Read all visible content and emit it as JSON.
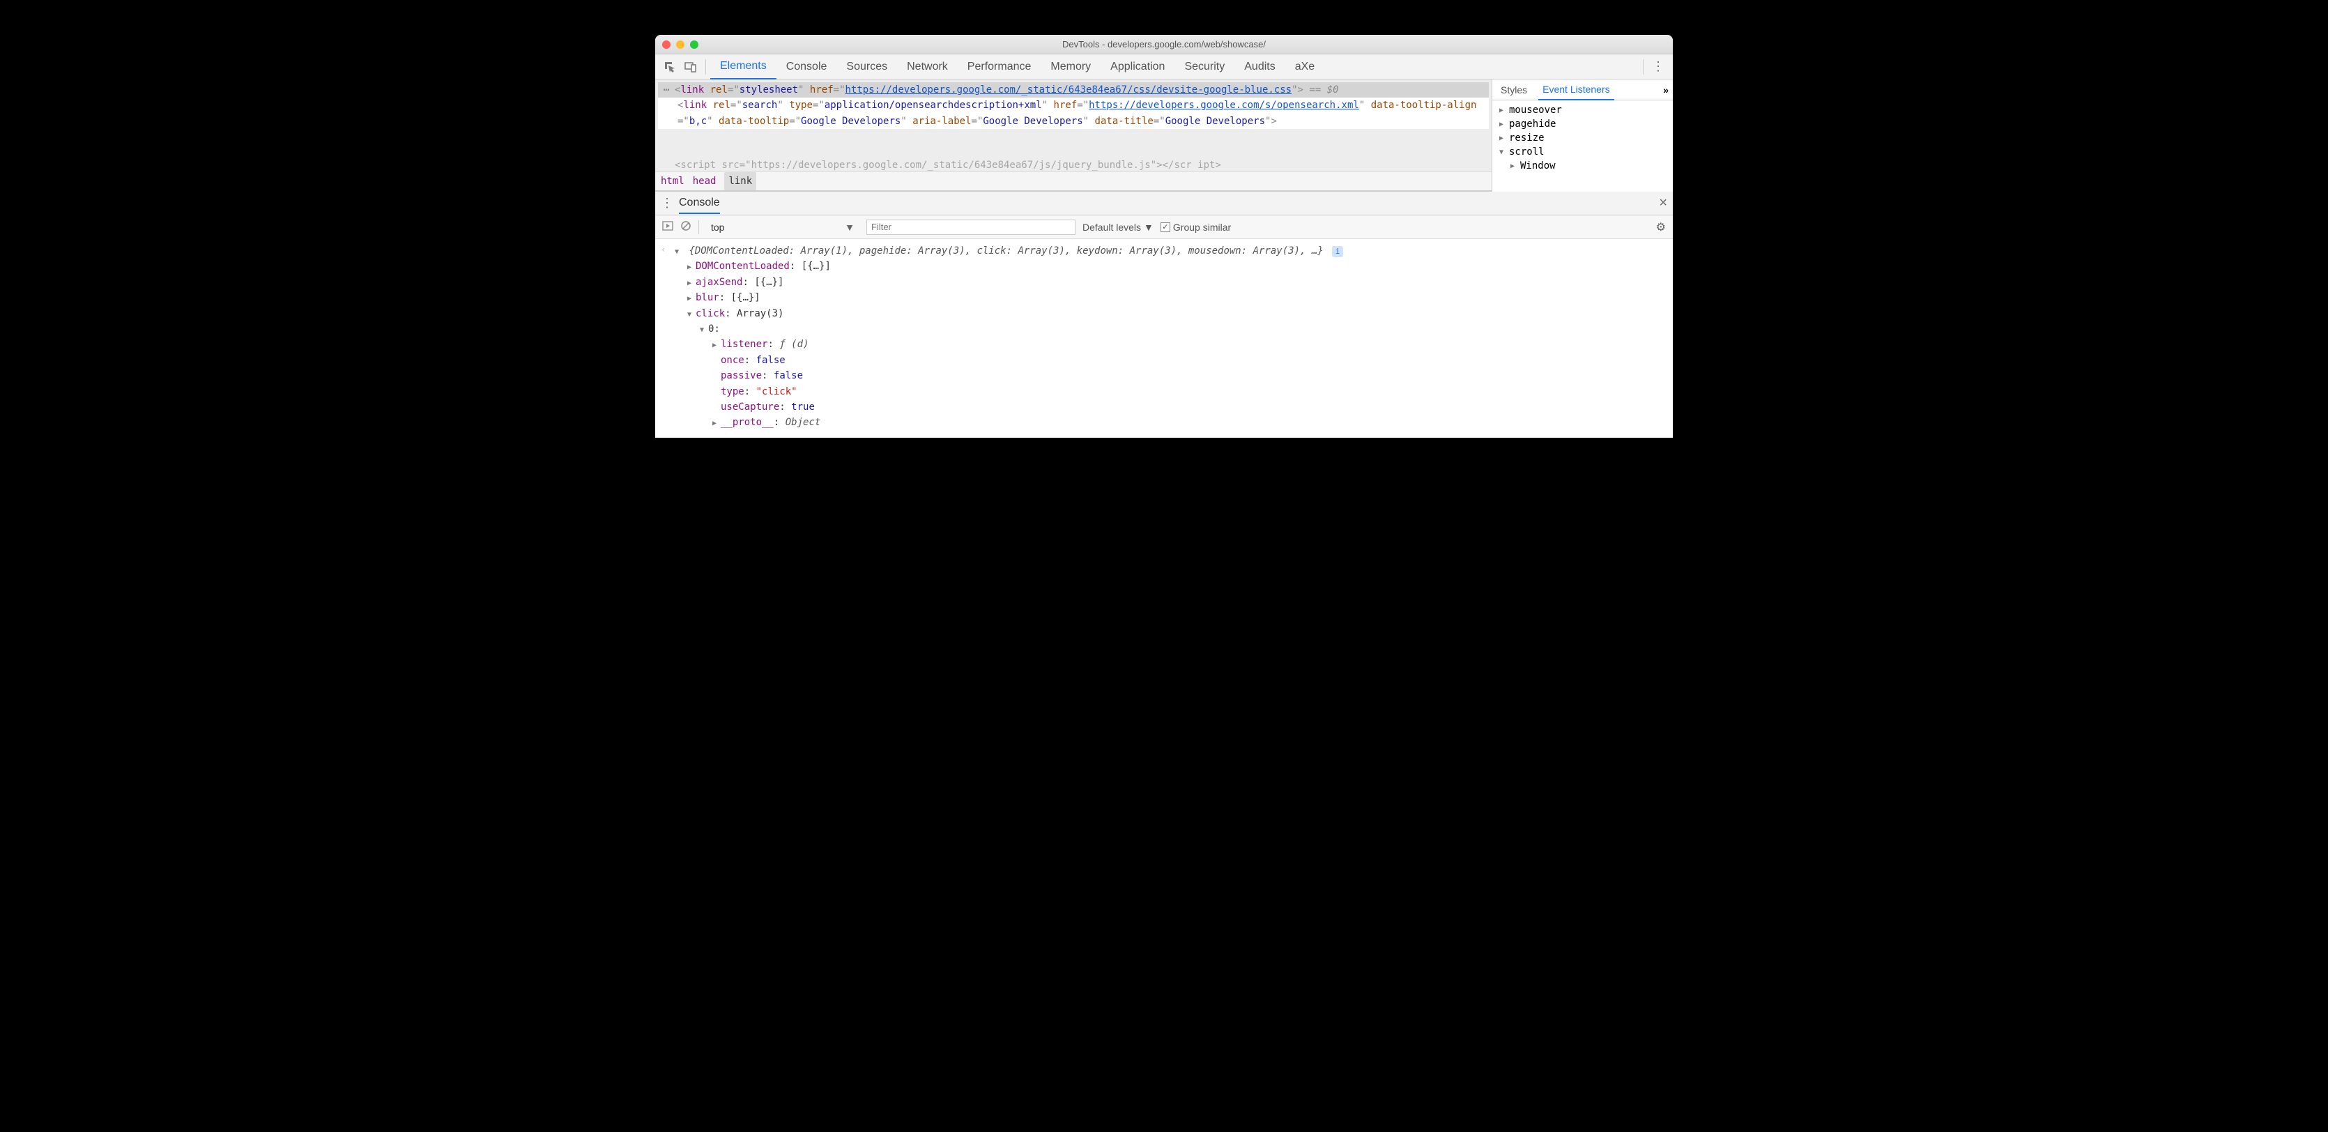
{
  "window": {
    "title": "DevTools - developers.google.com/web/showcase/"
  },
  "mainTabs": [
    "Elements",
    "Console",
    "Sources",
    "Network",
    "Performance",
    "Memory",
    "Application",
    "Security",
    "Audits",
    "aXe"
  ],
  "mainActiveTab": "Elements",
  "elements": {
    "selectedRow": {
      "gutter": "⋯",
      "prefix1": "<link ",
      "attr1n": "rel",
      "attr1v": "stylesheet",
      "attr2n": "href",
      "hrefLink": "https://developers.google.com/_static/643e84ea67/css/devsite-google-blue.css",
      "closing": ">",
      "eqdollar": " == $0"
    },
    "line2_parts": {
      "open": "<link ",
      "a1n": "rel",
      "a1v": "search",
      "a2n": "type",
      "a2v": "application/opensearchdescription+xml",
      "a3n": "href",
      "a3link": "https://developers.google.com/s/opensearch.xml",
      "a4n": "data-tooltip-align",
      "a4v": "b,c",
      "a5n": "data-tooltip",
      "a5v": "Google Developers",
      "a6n": "aria-label",
      "a6v": "Google Developers",
      "a7n": "data-title",
      "a7v": "Google Developers",
      "close": ">"
    },
    "cutoff": "<script src=\"https://developers.google.com/_static/643e84ea67/js/jquery_bundle.js\"></scr ipt>"
  },
  "breadcrumbs": [
    "html",
    "head",
    "link"
  ],
  "sidebar": {
    "tabs": [
      "Styles",
      "Event Listeners"
    ],
    "activeTab": "Event Listeners",
    "more": "»",
    "listeners": [
      {
        "name": "mouseover",
        "open": false
      },
      {
        "name": "pagehide",
        "open": false
      },
      {
        "name": "resize",
        "open": false
      },
      {
        "name": "scroll",
        "open": true,
        "children": [
          {
            "name": "Window",
            "open": false
          }
        ]
      }
    ]
  },
  "consoleDrawer": {
    "title": "Console",
    "context": "top",
    "filterPlaceholder": "Filter",
    "levelsLabel": "Default levels",
    "groupSimilar": "Group similar",
    "groupChecked": true
  },
  "consoleOutput": {
    "summary": "{DOMContentLoaded: Array(1), pagehide: Array(3), click: Array(3), keydown: Array(3), mousedown: Array(3), …}",
    "rows": [
      {
        "k": "DOMContentLoaded",
        "v": "[{…}]",
        "open": false,
        "ind": 1
      },
      {
        "k": "ajaxSend",
        "v": "[{…}]",
        "open": false,
        "ind": 1
      },
      {
        "k": "blur",
        "v": "[{…}]",
        "open": false,
        "ind": 1
      },
      {
        "k": "click",
        "v": "Array(3)",
        "open": true,
        "ind": 1
      },
      {
        "k": "0",
        "v": "",
        "open": true,
        "ind": 2,
        "plainkey": true
      },
      {
        "k": "listener",
        "v": "ƒ (d)",
        "open": false,
        "ind": 3,
        "italicv": true
      },
      {
        "k": "once",
        "v": "false",
        "ind": 3,
        "bool": true
      },
      {
        "k": "passive",
        "v": "false",
        "ind": 3,
        "bool": true
      },
      {
        "k": "type",
        "v": "\"click\"",
        "ind": 3,
        "str": true
      },
      {
        "k": "useCapture",
        "v": "true",
        "ind": 3,
        "bool": true
      },
      {
        "k": "__proto__",
        "v": "Object",
        "open": false,
        "ind": 3,
        "obj": true
      }
    ]
  }
}
